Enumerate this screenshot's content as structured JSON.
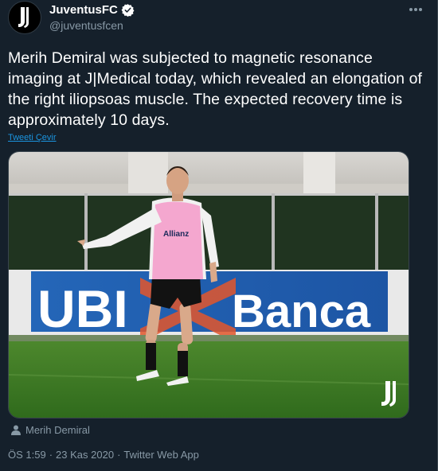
{
  "account": {
    "display_name": "JuventusFC",
    "handle": "@juventusfcen",
    "verified": true
  },
  "tweet": {
    "text": "Merih Demiral was subjected to magnetic resonance imaging at J|Medical today, which revealed an elongation of the right iliopsoas muscle. The expected recovery time is approximately 10 days.",
    "translate_label": "Tweeti Çevir"
  },
  "media": {
    "bib_sponsor": "Allianz",
    "board_left": "UBI",
    "board_right": "Banca",
    "watermark_icon": "juventus-logo-icon"
  },
  "tagged_user": "Merih Demiral",
  "meta": {
    "time": "ÖS 1:59",
    "separator": "·",
    "date": "23 Kas 2020",
    "source": "Twitter Web App"
  },
  "colors": {
    "background": "#15202b",
    "secondary_text": "#8899a6",
    "link": "#1b95e0",
    "verified": "#ffffff"
  }
}
